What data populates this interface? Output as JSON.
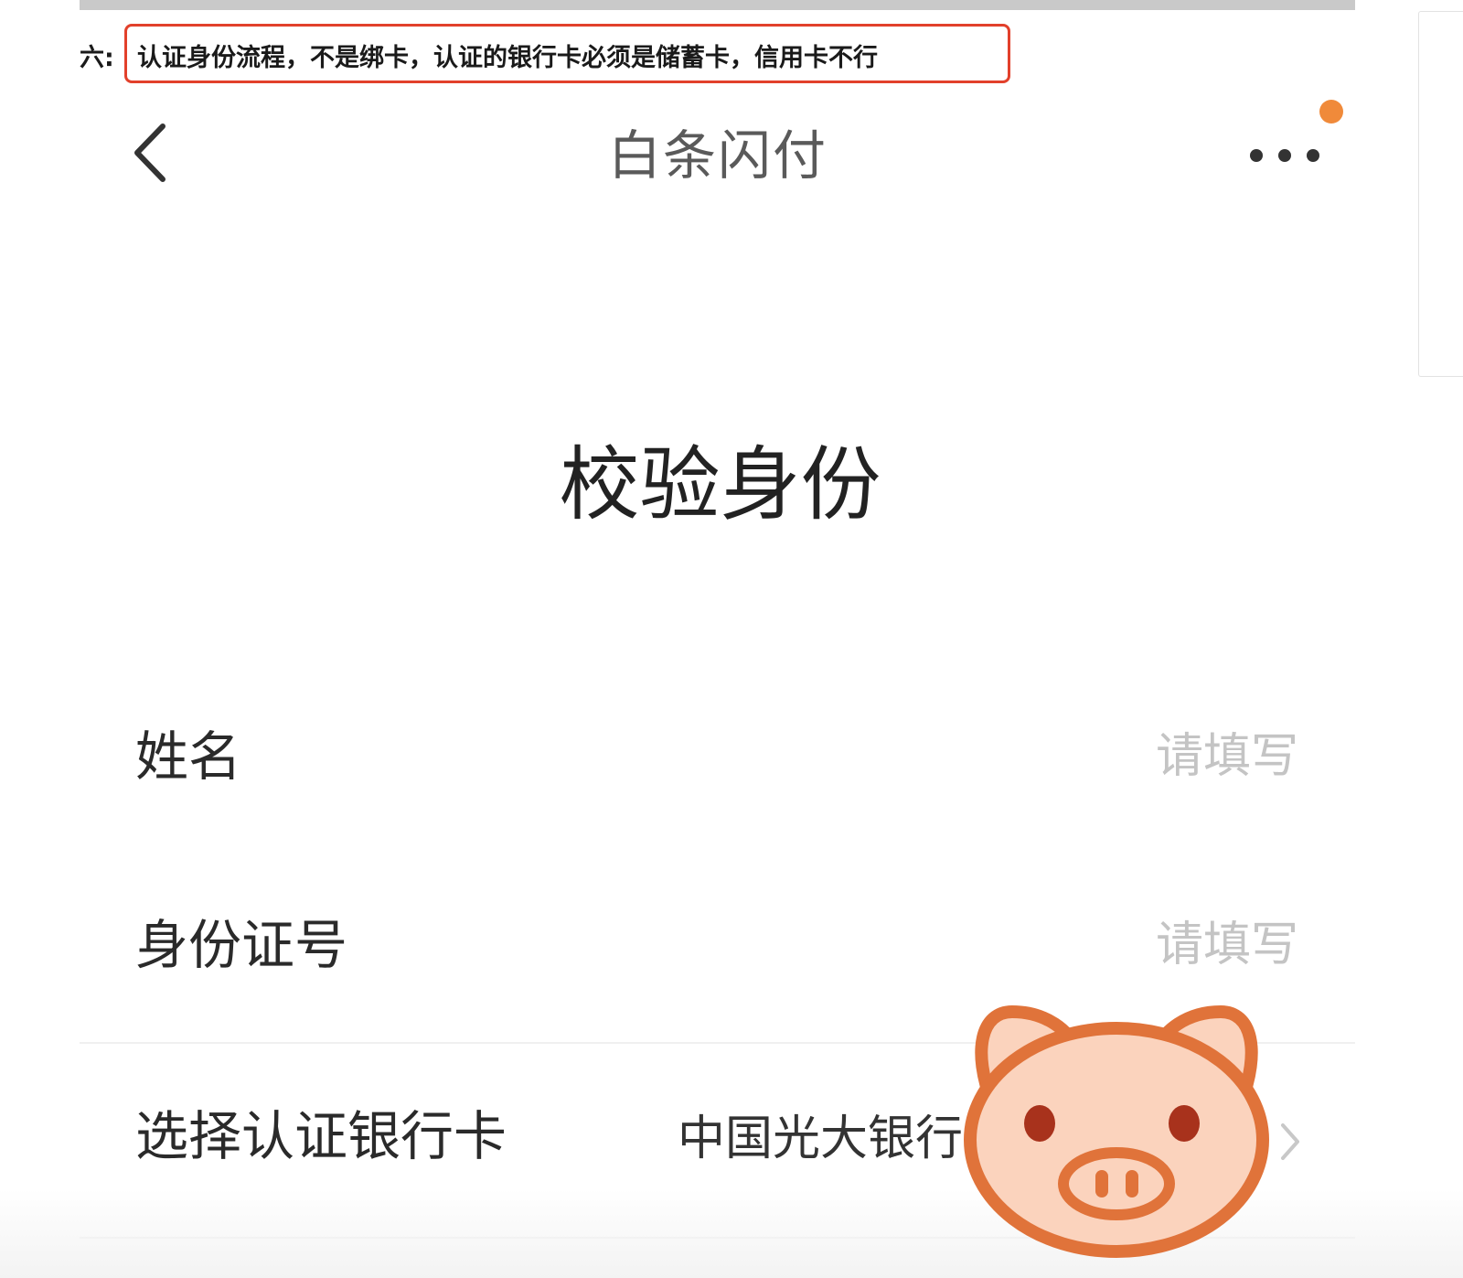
{
  "note": {
    "prefix": "六:",
    "text": "认证身份流程，不是绑卡，认证的银行卡必须是储蓄卡，信用卡不行",
    "highlight_color": "#e2402b"
  },
  "navbar": {
    "title": "白条闪付",
    "back_icon": "chevron-left-icon",
    "more_icon": "ellipsis-icon",
    "notification_dot_color": "#f08a3a"
  },
  "page": {
    "heading": "校验身份"
  },
  "form": {
    "name_label": "姓名",
    "name_placeholder": "请填写",
    "id_label": "身份证号",
    "id_placeholder": "请填写",
    "bank_label": "选择认证银行卡",
    "bank_value": "中国光大银行",
    "bank_icon": "chevron-right-icon"
  },
  "overlay": {
    "logo_icon": "pig-face-icon",
    "logo_color": "#e0733a"
  }
}
